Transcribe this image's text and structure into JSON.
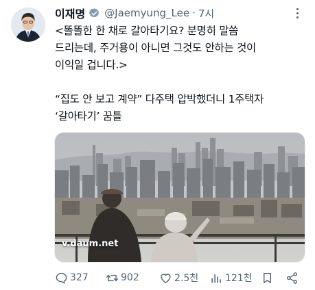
{
  "author": {
    "name": "이재명",
    "handle": "@Jaemyung_Lee",
    "separator": "·",
    "time": "7시"
  },
  "tweet": {
    "lines": [
      "<똘똘한 한 채로 갈아타기요? 분명히 말씀",
      "드리는데, 주거용이 아니면 그것도 안하는 것이",
      "이익일 겁니다.>",
      "",
      "“집도 안 보고 계약” 다주택 압박했더니 1주택자",
      "‘갈아타기’ 꿈틀"
    ]
  },
  "card": {
    "domain": "v.daum.net"
  },
  "actions": {
    "replies": "327",
    "reposts": "902",
    "likes": "2.5천",
    "views": "121천"
  },
  "icons": {
    "avatar": "profile-photo",
    "verified": "verified-badge-icon",
    "more": "more-dots-icon",
    "reply": "reply-bubble-icon",
    "repost": "repost-icon",
    "like": "heart-icon",
    "views": "views-bars-icon",
    "bookmark": "bookmark-icon",
    "share": "share-icon"
  },
  "colors": {
    "text": "#0f1419",
    "muted": "#536471",
    "verified": "#829aab"
  }
}
